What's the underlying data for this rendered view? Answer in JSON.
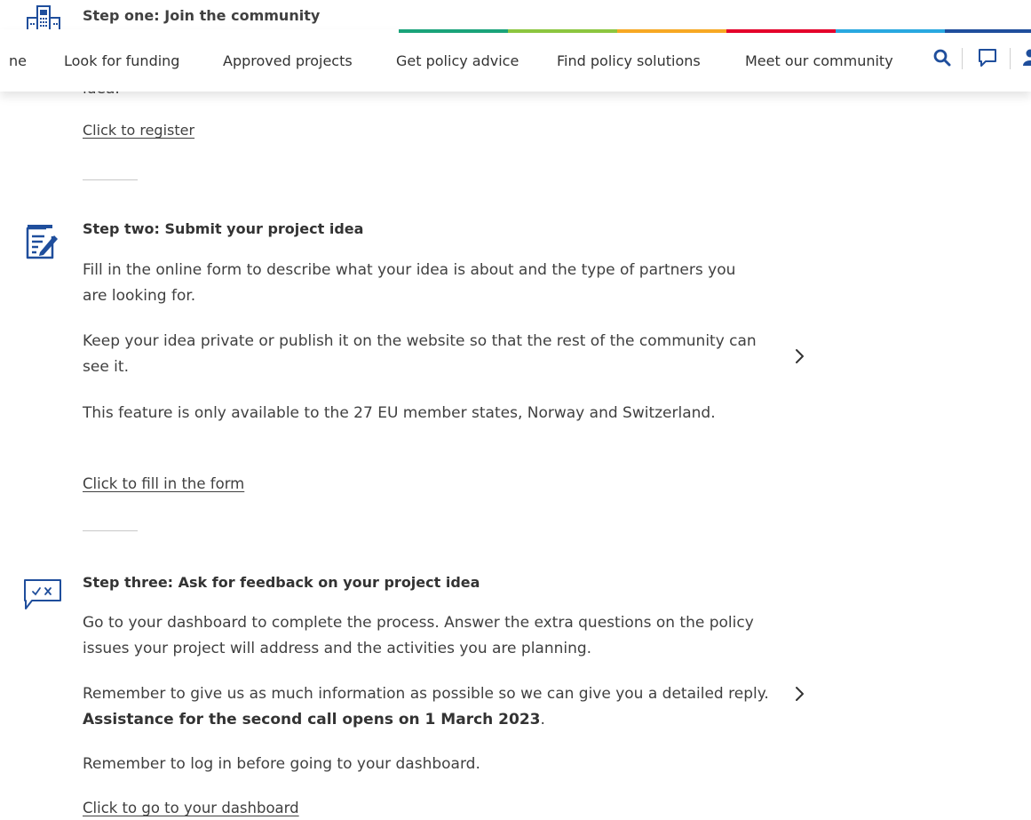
{
  "step_one": {
    "title": "Step one: Join the community",
    "partial_text": "idea.",
    "link": "Click to register"
  },
  "navbar": {
    "items": [
      {
        "label": "ne"
      },
      {
        "label": "Look for funding"
      },
      {
        "label": "Approved projects"
      },
      {
        "label": "Get policy advice"
      },
      {
        "label": "Find policy solutions"
      },
      {
        "label": "Meet our community"
      }
    ],
    "icons": [
      "search-icon",
      "chat-icon",
      "user-icon"
    ],
    "strip_colors": [
      "#1aa37a",
      "#8cc63f",
      "#f7a823",
      "#e4002b",
      "#29a8e0",
      "#1f4e9c"
    ]
  },
  "step_two": {
    "title": "Step two: Submit your project idea",
    "paragraphs": [
      "Fill in the online form to describe what your idea is about and the type of partners you are looking for.",
      "Keep your idea private or publish it on the website so that the rest of the community can see it.",
      "This feature is only available to the 27 EU member states, Norway and Switzerland."
    ],
    "link": "Click to fill in the form",
    "icon": "form-edit-icon"
  },
  "step_three": {
    "title": "Step three: Ask for feedback on your project idea",
    "paragraph1": "Go to your dashboard to complete the process. Answer the extra questions on the policy issues your project will address and the activities you are planning.",
    "paragraph2_start": "Remember to give us as much information as possible so we can give you a detailed reply. ",
    "paragraph2_bold": "Assistance for the second call opens on 1 March 2023",
    "paragraph2_end": ".",
    "paragraph3": "Remember to log in before going to your dashboard.",
    "link": "Click to go to your dashboard",
    "icon": "feedback-bubble-icon"
  },
  "colors": {
    "accent": "#1f4e9c",
    "text": "#404040"
  }
}
